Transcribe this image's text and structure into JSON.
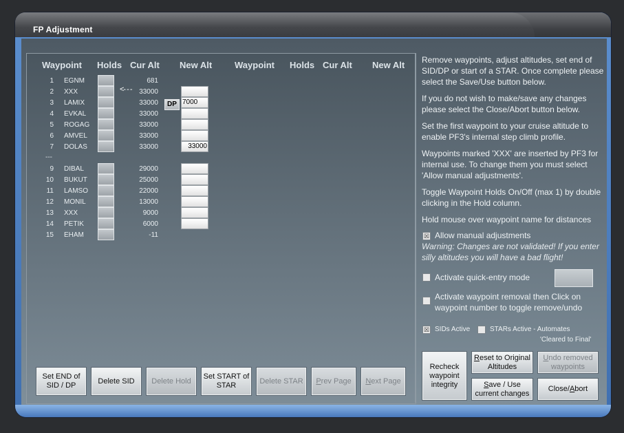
{
  "window": {
    "title": "FP Adjustment"
  },
  "table": {
    "headers": {
      "waypoint": "Waypoint",
      "holds": "Holds",
      "cur_alt": "Cur Alt",
      "new_alt": "New Alt",
      "waypoint2": "Waypoint",
      "holds2": "Holds",
      "cur_alt2": "Cur Alt",
      "new_alt2": "New Alt"
    },
    "rows_a": [
      {
        "num": "1",
        "wp": "EGNM",
        "alt": "681"
      },
      {
        "num": "2",
        "wp": "XXX",
        "alt": "33000"
      },
      {
        "num": "3",
        "wp": "LAMIX",
        "alt": "33000"
      },
      {
        "num": "4",
        "wp": "EVKAL",
        "alt": "33000"
      },
      {
        "num": "5",
        "wp": "ROGAG",
        "alt": "33000"
      },
      {
        "num": "6",
        "wp": "AMVEL",
        "alt": "33000"
      },
      {
        "num": "7",
        "wp": "DOLAS",
        "alt": "33000"
      }
    ],
    "separator": "---",
    "rows_b": [
      {
        "num": "9",
        "wp": "DIBAL",
        "alt": "29000"
      },
      {
        "num": "10",
        "wp": "BUKUT",
        "alt": "25000"
      },
      {
        "num": "11",
        "wp": "LAMSO",
        "alt": "22000"
      },
      {
        "num": "12",
        "wp": "MONIL",
        "alt": "13000"
      },
      {
        "num": "13",
        "wp": "XXX",
        "alt": "9000"
      },
      {
        "num": "14",
        "wp": "PETIK",
        "alt": "6000"
      },
      {
        "num": "15",
        "wp": "EHAM",
        "alt": "-11"
      }
    ],
    "new_alt_values": [
      "",
      "7000",
      "",
      "",
      "",
      "33000",
      "",
      "",
      "",
      "",
      "",
      ""
    ],
    "arrow": "<- - -",
    "dp_label": "DP"
  },
  "buttons": {
    "set_end_sid_line1": "Set END of",
    "set_end_sid_line2": "SID / DP",
    "delete_sid": "Delete SID",
    "delete_hold": "Delete Hold",
    "set_start_star_line1": "Set START of",
    "set_start_star_line2": "STAR",
    "delete_star": "Delete STAR",
    "prev_page_key": "P",
    "prev_page_rest": "rev Page",
    "next_page_key": "N",
    "next_page_rest": "ext Page",
    "recheck_line1": "Recheck",
    "recheck_line2": "waypoint",
    "recheck_line3": "integrity",
    "reset_key": "R",
    "reset_rest": "eset to Original",
    "reset_line2": "Altitudes",
    "undo_key": "U",
    "undo_rest": "ndo removed",
    "undo_line2": "waypoints",
    "save_key": "S",
    "save_rest": "ave / Use",
    "save_line2": "current changes",
    "close_pre": "Close/",
    "close_key": "A",
    "close_rest": "bort"
  },
  "help": {
    "p1": "Remove waypoints, adjust altitudes, set end of SID/DP or start of a STAR. Once complete please select the Save/Use button below.",
    "p2": "If you do not wish to make/save any changes please select the Close/Abort button below.",
    "p3": "Set the first waypoint to your cruise altitude to enable PF3's internal step climb profile.",
    "p4": "Waypoints marked 'XXX' are inserted by PF3 for internal use. To change them you must select 'Allow manual adjustments'.",
    "p5": "Toggle Waypoint Holds On/Off (max 1) by double clicking in the Hold column.",
    "p6": "Hold mouse over waypoint name for distances"
  },
  "options": {
    "allow_manual": "Allow manual adjustments",
    "allow_manual_checked": true,
    "warning": "Warning: Changes are not validated! If you enter silly altitudes you will have a bad flight!",
    "quick_entry": "Activate quick-entry mode",
    "quick_entry_checked": false,
    "removal_line1": "Activate waypoint removal then Click on",
    "removal_line2": "waypoint number to toggle remove/undo",
    "removal_checked": false,
    "sids_active": "SIDs Active",
    "sids_checked": true,
    "stars_active": "STARs Active - Automates",
    "stars_sub": "'Cleared to Final'",
    "stars_checked": false
  }
}
